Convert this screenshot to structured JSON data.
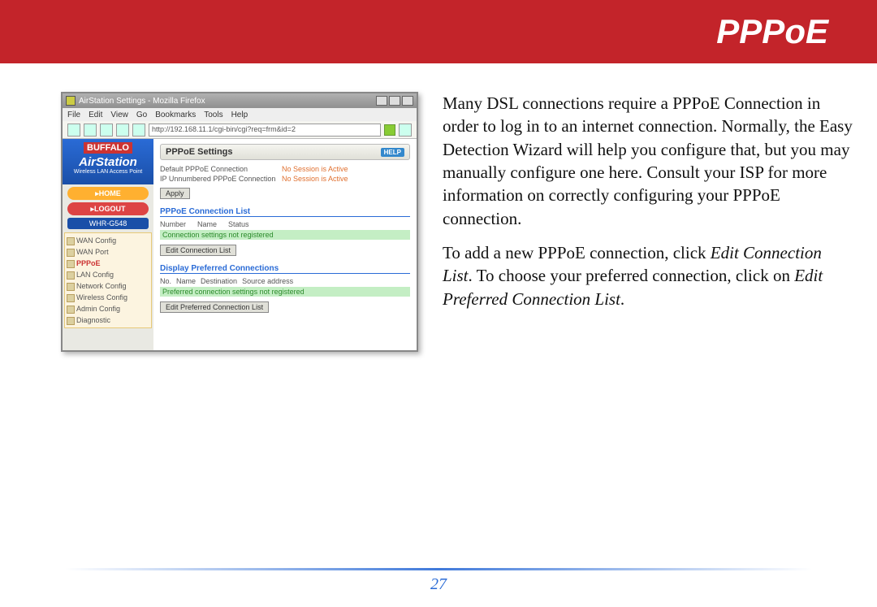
{
  "header": {
    "title": "PPPoE"
  },
  "screenshot": {
    "window_title": "AirStation Settings - Mozilla Firefox",
    "menu": [
      "File",
      "Edit",
      "View",
      "Go",
      "Bookmarks",
      "Tools",
      "Help"
    ],
    "address": "http://192.168.11.1/cgi-bin/cgi?req=frm&id=2",
    "brand": {
      "logo": "BUFFALO",
      "product": "AirStation",
      "sub": "Wireless LAN Access Point"
    },
    "home_btn": "HOME",
    "logout_btn": "LOGOUT",
    "model": "WHR-G548",
    "nav": [
      "WAN Config",
      "WAN Port",
      "PPPoE",
      "LAN Config",
      "Network Config",
      "Wireless Config",
      "Admin Config",
      "Diagnostic"
    ],
    "panel_title": "PPPoE Settings",
    "help_label": "HELP",
    "row1_label": "Default PPPoE Connection",
    "row1_val": "No Session is Active",
    "row2_label": "IP Unnumbered PPPoE Connection",
    "row2_val": "No Session is Active",
    "apply_btn": "Apply",
    "sect_connlist": "PPPoE Connection List",
    "connlist_cols": [
      "Number",
      "Name",
      "Status"
    ],
    "connlist_empty": "Connection settings not registered",
    "edit_connlist_btn": "Edit Connection List",
    "sect_pref": "Display Preferred Connections",
    "pref_cols": [
      "No.",
      "Name",
      "Destination",
      "Source address"
    ],
    "pref_empty": "Preferred connection settings not registered",
    "edit_pref_btn": "Edit Preferred Connection List"
  },
  "body": {
    "p1": "Many DSL connections require a PPPoE Connection in order to log in to an internet connection.  Normally, the Easy Detection Wizard will help you configure that, but you may manually configure one here.  Consult your ISP for more information on correctly configuring your PPPoE connection.",
    "p2a": "To add a new PPPoE connection, click ",
    "p2b": "Edit Connection List",
    "p2c": ".  To choose your preferred connection, click on ",
    "p2d": "Edit Preferred Connection List",
    "p2e": "."
  },
  "page_number": "27"
}
